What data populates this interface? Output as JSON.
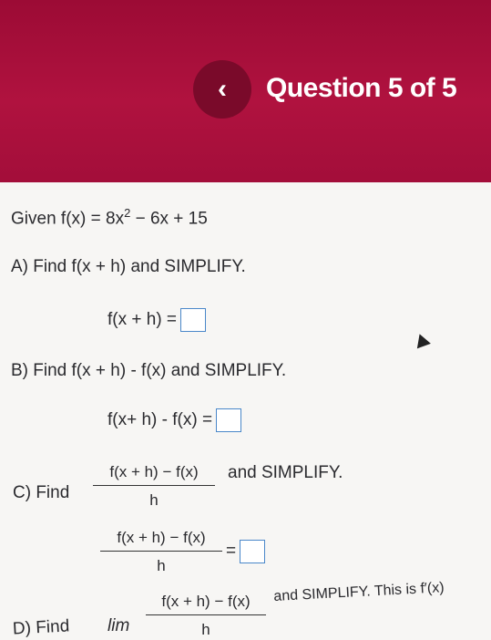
{
  "header": {
    "back_icon": "chevron-left-icon",
    "back_glyph": "‹",
    "title": "Question 5 of 5"
  },
  "question": {
    "given_prefix": "Given f(x) = 8x",
    "given_exp": "2",
    "given_suffix": " − 6x + 15",
    "part_a": "A) Find f(x + h) and SIMPLIFY.",
    "part_a_eq": "f(x + h) =",
    "part_b": "B) Find f(x + h) - f(x)  and SIMPLIFY.",
    "part_b_eq": "f(x+ h) - f(x) =",
    "part_c_prefix": "C) Find",
    "part_c_num": "f(x + h) − f(x)",
    "part_c_den": "h",
    "part_c_suffix": "and SIMPLIFY.",
    "part_c_eq_num": "f(x + h) − f(x)",
    "part_c_eq_den": "h",
    "part_c_eq_sign": "=",
    "part_d_prefix": "D) Find",
    "part_d_lim": "lim",
    "part_d_num": "f(x + h) − f(x)",
    "part_d_den": "h",
    "part_d_suffix": "and SIMPLIFY.  This is f′(x)"
  }
}
